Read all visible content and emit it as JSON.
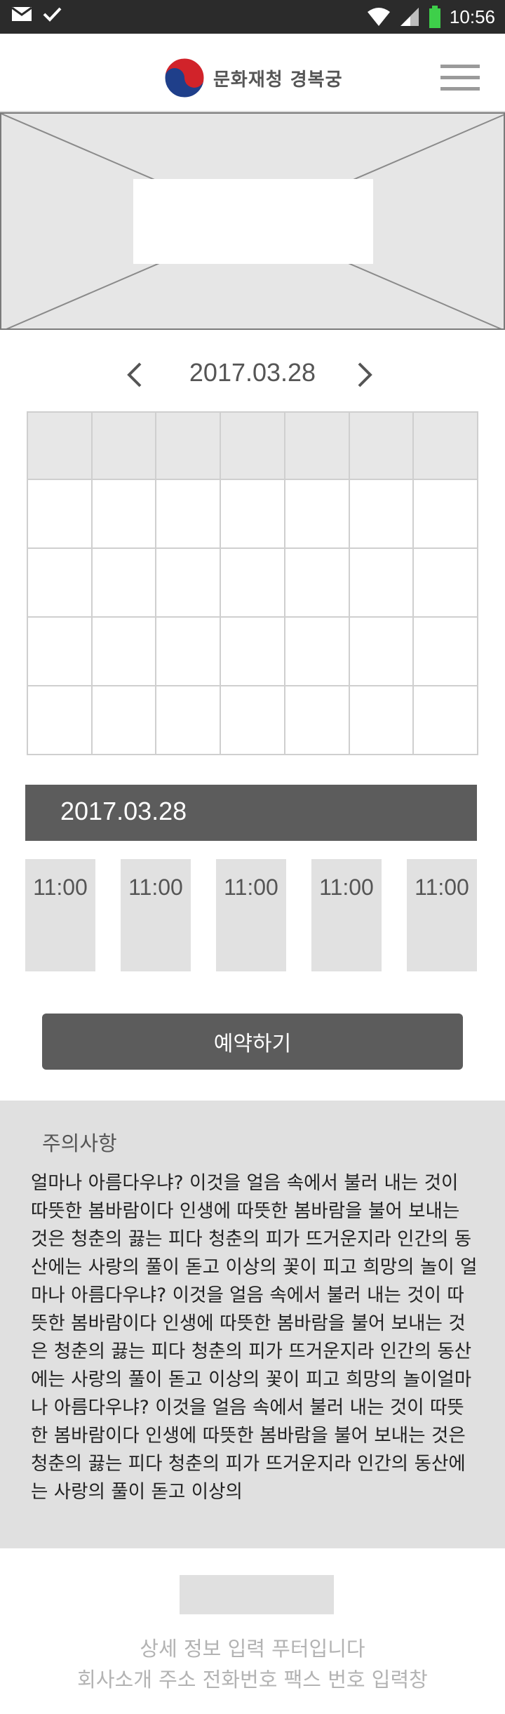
{
  "status_bar": {
    "time": "10:56",
    "icons": [
      "mail-icon",
      "check-icon",
      "wifi-icon",
      "signal-icon",
      "battery-icon"
    ],
    "battery_color": "#3ecf4a"
  },
  "header": {
    "logo_text": "문화재청 경복궁",
    "menu_icon": "hamburger-menu-icon"
  },
  "date_nav": {
    "date": "2017.03.28",
    "prev_icon": "chevron-left-icon",
    "next_icon": "chevron-right-icon"
  },
  "calendar": {
    "columns": 7,
    "header_rows": 1,
    "week_rows": 4
  },
  "selected_date": "2017.03.28",
  "time_slots": [
    "11:00",
    "11:00",
    "11:00",
    "11:00",
    "11:00"
  ],
  "reserve_button": "예약하기",
  "notice": {
    "title": "주의사항",
    "body": "얼마나 아름다우냐? 이것을 얼음 속에서 불러 내는 것이 따뜻한 봄바람이다 인생에 따뜻한 봄바람을 불어 보내는 것은 청춘의 끓는 피다 청춘의 피가 뜨거운지라 인간의 동산에는 사랑의 풀이 돋고 이상의 꽃이 피고 희망의 놀이 얼마나 아름다우냐? 이것을 얼음 속에서 불러 내는 것이 따뜻한 봄바람이다 인생에 따뜻한 봄바람을 불어 보내는 것은 청춘의 끓는 피다 청춘의 피가 뜨거운지라 인간의 동산에는 사랑의 풀이 돋고 이상의 꽃이 피고 희망의 놀이얼마나 아름다우냐? 이것을 얼음 속에서 불러 내는 것이 따뜻한 봄바람이다 인생에 따뜻한 봄바람을 불어 보내는 것은 청춘의 끓는 피다 청춘의 피가 뜨거운지라 인간의 동산에는 사랑의 풀이 돋고 이상의"
  },
  "footer": {
    "line1": "상세 정보 입력 푸터입니다",
    "line2": "회사소개 주소 전화번호 팩스 번호 입력창"
  },
  "colors": {
    "dark_bar": "#5c5c5c",
    "placeholder_gray": "#e0e0e0",
    "footer_text": "#b3b3b3"
  }
}
